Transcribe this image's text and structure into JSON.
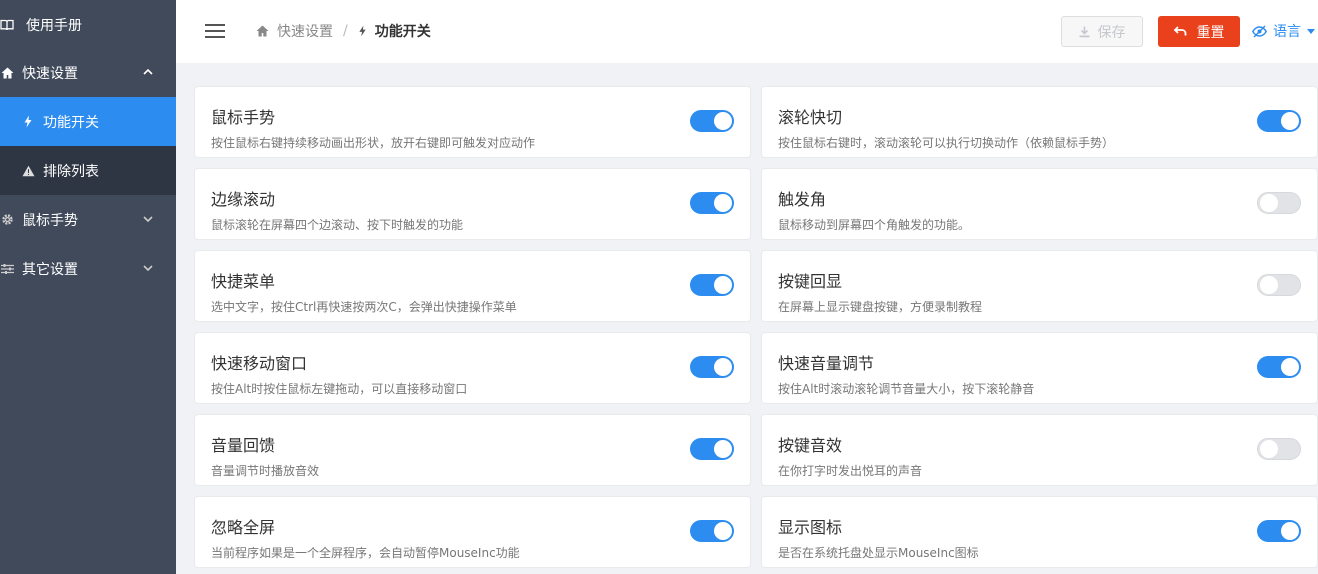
{
  "sidebar": {
    "items": [
      {
        "label": "使用手册",
        "icon": "book-icon"
      },
      {
        "label": "快速设置",
        "icon": "home-icon",
        "expanded": true
      },
      {
        "label": "功能开关",
        "icon": "bolt-icon",
        "active": true
      },
      {
        "label": "排除列表",
        "icon": "warning-icon"
      },
      {
        "label": "鼠标手势",
        "icon": "gear-icon"
      },
      {
        "label": "其它设置",
        "icon": "sliders-icon"
      }
    ]
  },
  "header": {
    "breadcrumb": {
      "home": "快速设置",
      "separator": "/",
      "current": "功能开关"
    },
    "save_label": "保存",
    "reset_label": "重置",
    "language_label": "语言"
  },
  "colors": {
    "accent": "#2d8cf0",
    "danger": "#e8411c",
    "sidebar": "#404a5b"
  },
  "features_left": [
    {
      "title": "鼠标手势",
      "desc": "按住鼠标右键持续移动画出形状，放开右键即可触发对应动作",
      "enabled": true
    },
    {
      "title": "边缘滚动",
      "desc": "鼠标滚轮在屏幕四个边滚动、按下时触发的功能",
      "enabled": true
    },
    {
      "title": "快捷菜单",
      "desc": "选中文字，按住Ctrl再快速按两次C，会弹出快捷操作菜单",
      "enabled": true
    },
    {
      "title": "快速移动窗口",
      "desc": "按住Alt时按住鼠标左键拖动，可以直接移动窗口",
      "enabled": true
    },
    {
      "title": "音量回馈",
      "desc": "音量调节时播放音效",
      "enabled": true
    },
    {
      "title": "忽略全屏",
      "desc": "当前程序如果是一个全屏程序，会自动暂停MouseInc功能",
      "enabled": true
    }
  ],
  "features_right": [
    {
      "title": "滚轮快切",
      "desc": "按住鼠标右键时，滚动滚轮可以执行切换动作（依赖鼠标手势）",
      "enabled": true
    },
    {
      "title": "触发角",
      "desc": "鼠标移动到屏幕四个角触发的功能。",
      "enabled": false
    },
    {
      "title": "按键回显",
      "desc": "在屏幕上显示键盘按键，方便录制教程",
      "enabled": false
    },
    {
      "title": "快速音量调节",
      "desc": "按住Alt时滚动滚轮调节音量大小，按下滚轮静音",
      "enabled": true
    },
    {
      "title": "按键音效",
      "desc": "在你打字时发出悦耳的声音",
      "enabled": false
    },
    {
      "title": "显示图标",
      "desc": "是否在系统托盘处显示MouseInc图标",
      "enabled": true
    }
  ]
}
